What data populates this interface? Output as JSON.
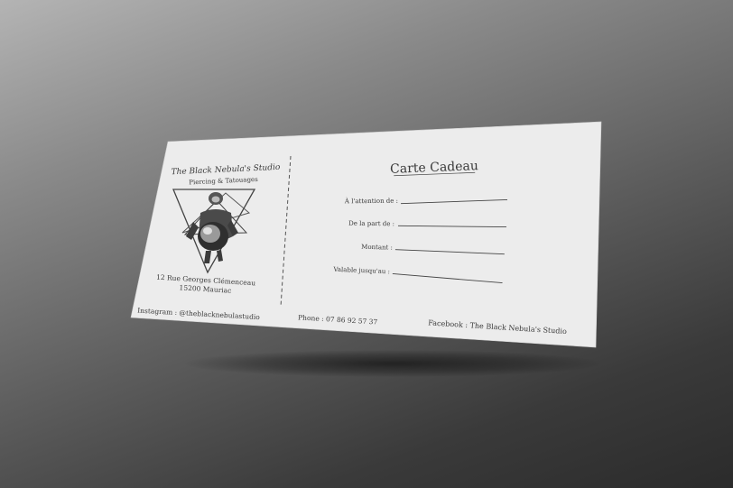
{
  "studio": {
    "name": "The Black Nebula's Studio",
    "subtitle": "Piercing & Tatouages",
    "address_line1": "12 Rue Georges Clémenceau",
    "address_line2": "15200 Mauriac"
  },
  "voucher": {
    "title": "Carte Cadeau",
    "fields": [
      {
        "label": "À l'attention de :"
      },
      {
        "label": "De la part de :"
      },
      {
        "label": "Montant :"
      },
      {
        "label": "Valable jusqu'au :"
      }
    ]
  },
  "footer": {
    "instagram": "Instagram : @theblacknebulastudio",
    "phone": "Phone :   07 86 92 57 37",
    "facebook": "Facebook :  The Black Nebula's Studio"
  },
  "colors": {
    "card": "#ededed",
    "ink": "#3a3a3a"
  },
  "icons": [
    "astronaut-emblem-icon",
    "triangle-frame-icon"
  ]
}
